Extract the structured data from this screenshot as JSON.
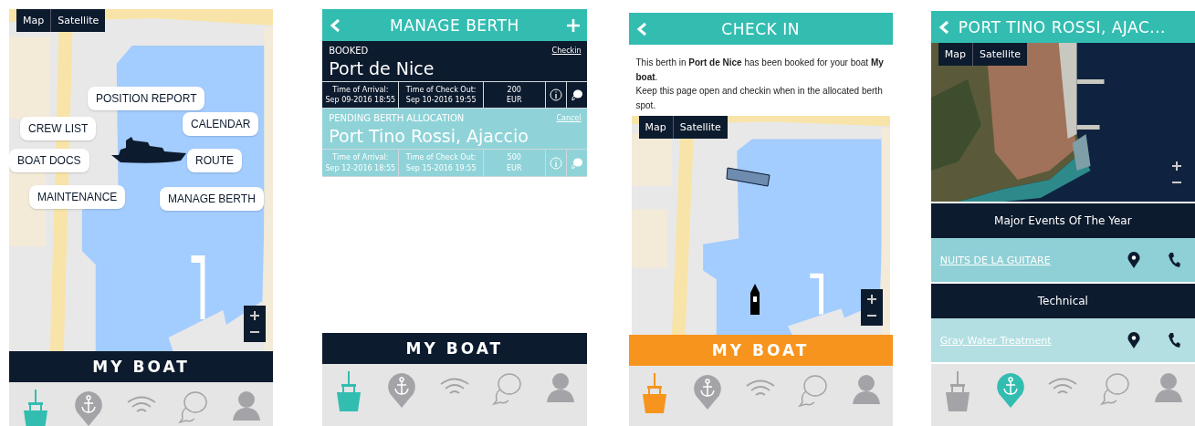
{
  "screens": [
    {
      "kind": "home",
      "map": {
        "kind": "roadmap",
        "map_types": [
          "Map",
          "Satellite"
        ]
      },
      "menu": [
        {
          "label": "POSITION REPORT"
        },
        {
          "label": "CREW LIST"
        },
        {
          "label": "CALENDAR"
        },
        {
          "label": "BOAT DOCS"
        },
        {
          "label": "ROUTE"
        },
        {
          "label": "MAINTENANCE"
        },
        {
          "label": "MANAGE BERTH"
        }
      ],
      "my_boat": {
        "label": "MY BOAT",
        "active": false
      },
      "tabs": [
        {
          "kind": "boat",
          "selected": true
        },
        {
          "kind": "anchor",
          "selected": false
        },
        {
          "kind": "wifi",
          "selected": false
        },
        {
          "kind": "chat",
          "selected": false
        },
        {
          "kind": "user",
          "selected": false
        }
      ]
    },
    {
      "kind": "berths",
      "header": {
        "title": "MANAGE BERTH"
      },
      "bookings": [
        {
          "kind": "booked",
          "status": "BOOKED",
          "action": "Checkin",
          "port": "Port de Nice",
          "arrival_label": "Time of Arrival:",
          "arrival": "Sep 09-2016 18:55",
          "checkout_label": "Time of Check Out:",
          "checkout": "Sep 10-2016 19:55",
          "price": "200",
          "currency": "EUR"
        },
        {
          "kind": "pending",
          "status": "PENDING BERTH ALLOCATION",
          "action": "Cancel",
          "port": "Port Tino Rossi, Ajaccio",
          "arrival_label": "Time of Arrival:",
          "arrival": "Sep 12-2016 18:55",
          "checkout_label": "Time of Check Out:",
          "checkout": "Sep 15-2016 19:55",
          "price": "500",
          "currency": "EUR"
        }
      ],
      "my_boat": {
        "label": "MY BOAT",
        "active": false
      },
      "tabs": [
        {
          "kind": "boat",
          "selected": true
        },
        {
          "kind": "anchor",
          "selected": false
        },
        {
          "kind": "wifi",
          "selected": false
        },
        {
          "kind": "chat",
          "selected": false
        },
        {
          "kind": "user",
          "selected": false
        }
      ]
    },
    {
      "kind": "checkin",
      "header": {
        "title": "CHECK IN"
      },
      "paragraphs": [
        "This berth in **Port de Nice** has been booked for your boat **My boat**.",
        "Keep this page open and checkin when in the allocated berth spot."
      ],
      "map": {
        "kind": "roadmap",
        "map_types": [
          "Map",
          "Satellite"
        ]
      },
      "my_boat": {
        "label": "MY BOAT",
        "active": true
      },
      "tabs": [
        {
          "kind": "boat",
          "selected": true
        },
        {
          "kind": "anchor",
          "selected": false
        },
        {
          "kind": "wifi",
          "selected": false
        },
        {
          "kind": "chat",
          "selected": false
        },
        {
          "kind": "user",
          "selected": false
        }
      ]
    },
    {
      "kind": "port",
      "header": {
        "title": "PORT TINO ROSSI, AJAC..."
      },
      "map": {
        "kind": "satellite",
        "map_types": [
          "Map",
          "Satellite"
        ]
      },
      "sections": [
        {
          "heading": "Major Events Of The Year",
          "items": [
            {
              "label": "NUITS DE LA GUITARE"
            }
          ]
        },
        {
          "heading": "Technical",
          "items": [
            {
              "label": "Gray Water Treatment"
            }
          ]
        }
      ],
      "tabs": [
        {
          "kind": "boat",
          "selected": false
        },
        {
          "kind": "anchor",
          "selected": true
        },
        {
          "kind": "wifi",
          "selected": false
        },
        {
          "kind": "chat",
          "selected": false
        },
        {
          "kind": "user",
          "selected": false
        }
      ]
    }
  ]
}
